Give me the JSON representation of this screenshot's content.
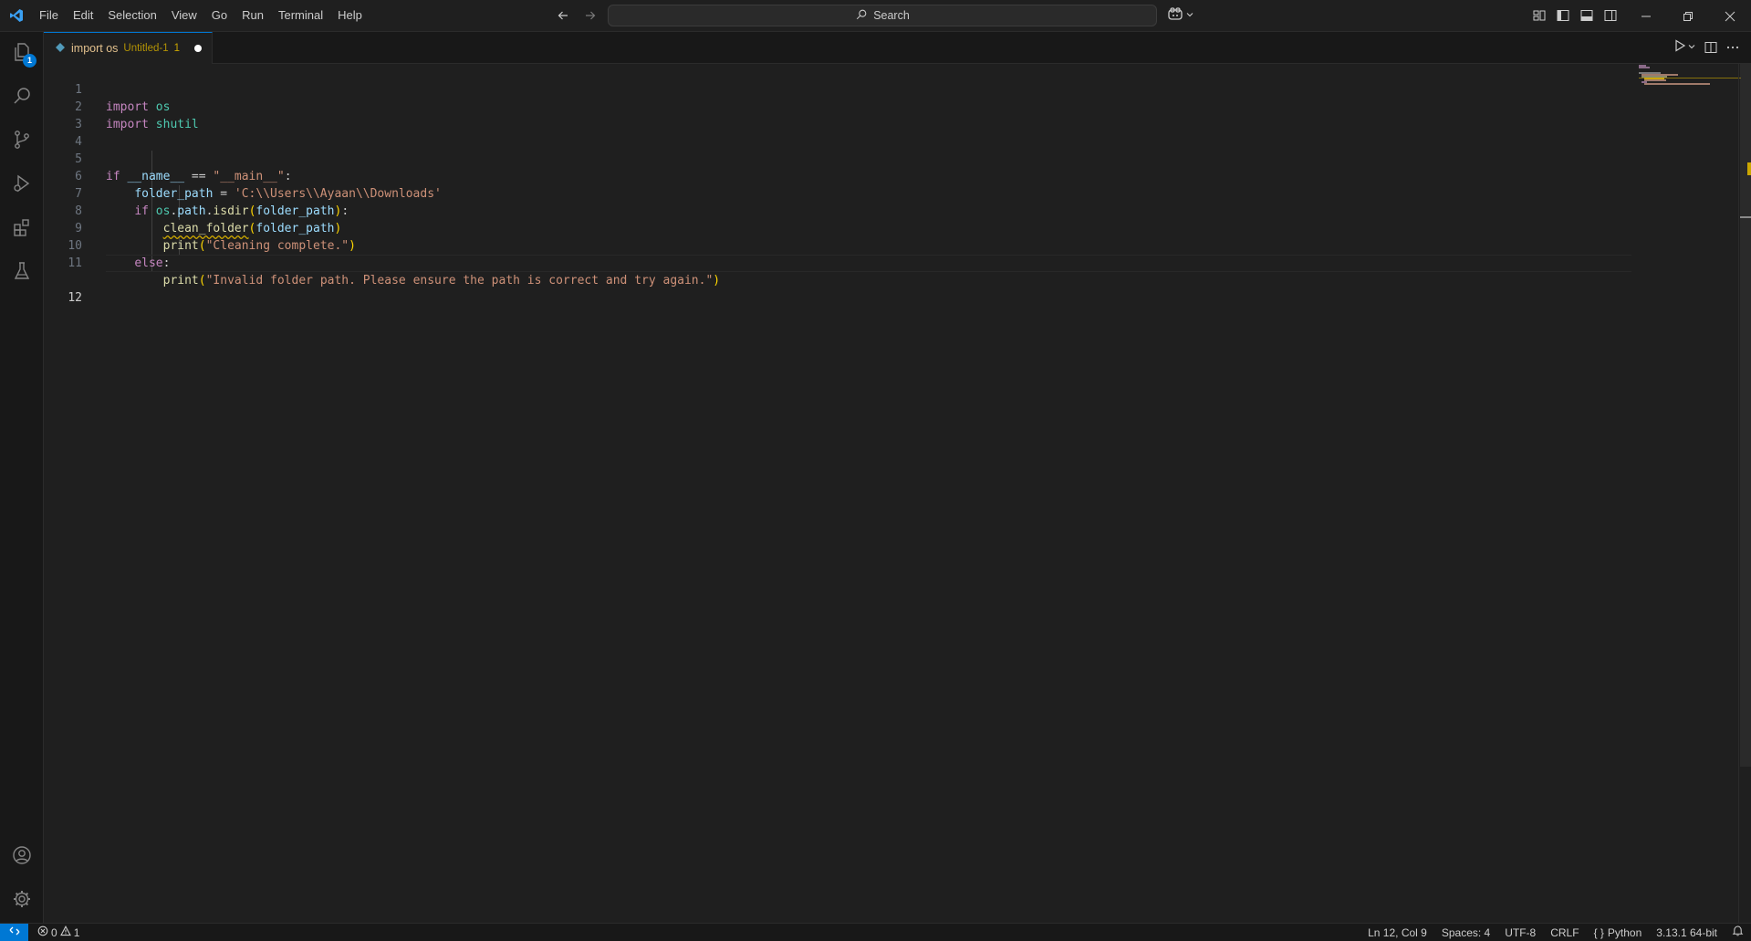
{
  "titlebar": {
    "menu": [
      "File",
      "Edit",
      "Selection",
      "View",
      "Go",
      "Run",
      "Terminal",
      "Help"
    ],
    "search_label": "Search"
  },
  "activity_bar": {
    "explorer_badge": "1"
  },
  "tab": {
    "title": "import os",
    "description": "Untitled-1",
    "problem_count": "1"
  },
  "editor": {
    "line_numbers": [
      "1",
      "2",
      "3",
      "4",
      "5",
      "6",
      "7",
      "8",
      "9",
      "10",
      "11",
      "12"
    ],
    "active_line": 12,
    "lines": [
      "import os",
      "import shutil",
      "",
      "",
      "if __name__ == \"__main__\":",
      "    folder_path = 'C:\\\\Users\\\\Ayaan\\\\Downloads'",
      "    if os.path.isdir(folder_path):",
      "        clean_folder(folder_path)",
      "        print(\"Cleaning complete.\")",
      "    else:",
      "        print(\"Invalid folder path. Please ensure the path is correct and try again.\")",
      ""
    ],
    "tokens": {
      "import": "import",
      "os": "os",
      "shutil": "shutil",
      "if": "if",
      "name_var": "__name__",
      "eq": " == ",
      "main_str": "\"__main__\"",
      "colon": ":",
      "folder_path": "folder_path",
      "assign": " = ",
      "path_str": "'C:\\\\Users\\\\Ayaan\\\\Downloads'",
      "path": "path",
      "isdir": "isdir",
      "clean_folder": "clean_folder",
      "print": "print",
      "cleaning_str": "\"Cleaning complete.\"",
      "else": "else",
      "invalid_str": "\"Invalid folder path. Please ensure the path is correct and try again.\"",
      "dot": ".",
      "lparen": "(",
      "rparen": ")"
    }
  },
  "statusbar": {
    "errors": "0",
    "warnings": "1",
    "position": "Ln 12, Col 9",
    "spaces": "Spaces: 4",
    "encoding": "UTF-8",
    "eol": "CRLF",
    "language": "Python",
    "interpreter": "3.13.1 64-bit"
  },
  "colors": {
    "accent": "#0078d4",
    "keyword": "#c586c0",
    "module": "#4ec9b0",
    "variable": "#9cdcfe",
    "function": "#dcdcaa",
    "string": "#ce9178",
    "warning": "#cca700"
  }
}
